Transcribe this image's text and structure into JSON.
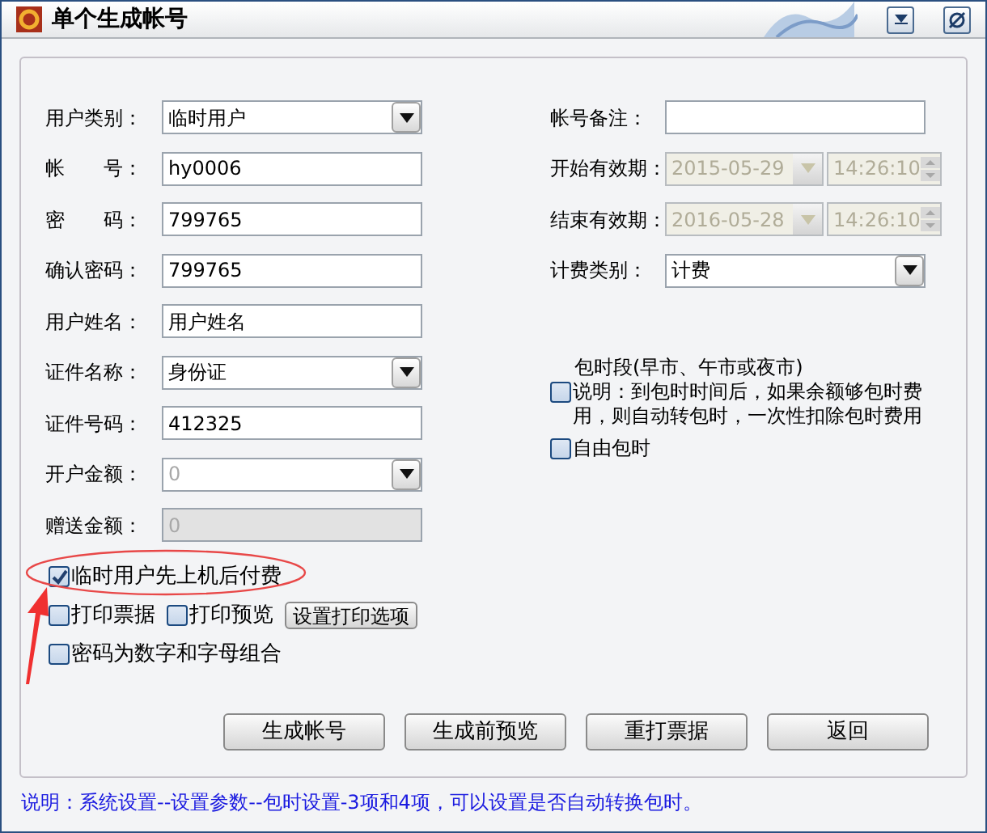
{
  "window": {
    "title": "单个生成帐号"
  },
  "left_fields": [
    {
      "label": "用户类别：",
      "kind": "select",
      "value": "临时用户",
      "disabled": false
    },
    {
      "label": "帐　　号：",
      "kind": "text",
      "value": "hy0006",
      "disabled": false
    },
    {
      "label": "密　　码：",
      "kind": "text",
      "value": "799765",
      "disabled": false
    },
    {
      "label": "确认密码：",
      "kind": "text",
      "value": "799765",
      "disabled": false
    },
    {
      "label": "用户姓名：",
      "kind": "text",
      "value": "用户姓名",
      "disabled": false
    },
    {
      "label": "证件名称：",
      "kind": "select",
      "value": "身份证",
      "disabled": false
    },
    {
      "label": "证件号码：",
      "kind": "text",
      "value": "412325",
      "disabled": false
    },
    {
      "label": "开户金额：",
      "kind": "select",
      "value": "0",
      "disabled": true
    },
    {
      "label": "赠送金额：",
      "kind": "text",
      "value": "0",
      "disabled": true
    }
  ],
  "right_fields": [
    {
      "label": "帐号备注：",
      "kind": "text",
      "disabled": false
    },
    {
      "label": "开始有效期：",
      "kind": "datetime",
      "date": "2015-05-29",
      "time": "14:26:10",
      "disabled": true
    },
    {
      "label": "结束有效期：",
      "kind": "datetime",
      "date": "2016-05-28",
      "time": "14:26:10",
      "disabled": true
    },
    {
      "label": "计费类别：",
      "kind": "select",
      "value": "计费",
      "disabled": false
    }
  ],
  "package": {
    "title": "包时段(早市、午市或夜市)",
    "description": "说明：到包时时间后，如果余额够包时费用，则自动转包时，一次性扣除包时费用",
    "checked": false
  },
  "free_package": {
    "label": "自由包时",
    "checked": false
  },
  "option_rows": [
    {
      "items": [
        {
          "kind": "checkbox",
          "label": "临时用户先上机后付费",
          "checked": true
        }
      ]
    },
    {
      "items": [
        {
          "kind": "checkbox",
          "label": "打印票据",
          "checked": false
        },
        {
          "kind": "checkbox",
          "label": "打印预览",
          "checked": false
        },
        {
          "kind": "button",
          "label": "设置打印选项"
        }
      ]
    },
    {
      "items": [
        {
          "kind": "checkbox",
          "label": "密码为数字和字母组合",
          "checked": false
        }
      ]
    }
  ],
  "buttons": [
    "生成帐号",
    "生成前预览",
    "重打票据",
    "返回"
  ],
  "footer": "说明：系统设置--设置参数--包时设置-3项和4项，可以设置是否自动转换包时。"
}
